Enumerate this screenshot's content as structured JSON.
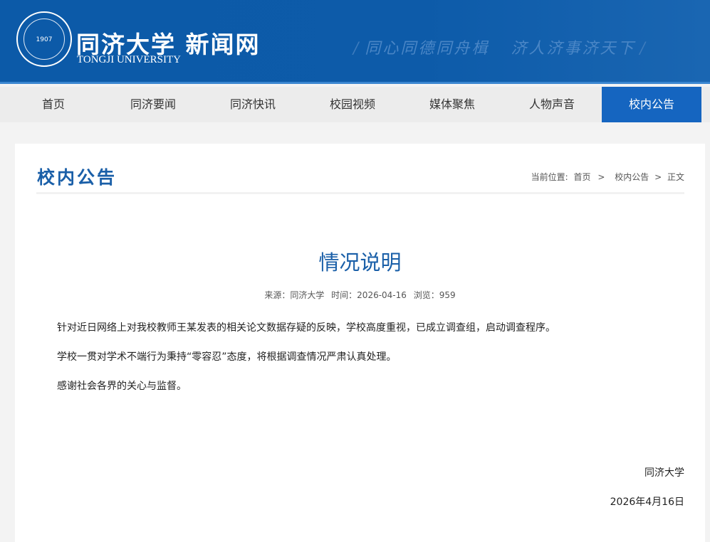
{
  "header": {
    "logo_cn": "同济大学 新闻网",
    "logo_en": "TONGJI UNIVERSITY",
    "seal_text": "1907",
    "motto": [
      "同心同德同舟楫",
      "济人济事济天下"
    ]
  },
  "nav": {
    "items": [
      {
        "label": "首页"
      },
      {
        "label": "同济要闻"
      },
      {
        "label": "同济快讯"
      },
      {
        "label": "校园视频"
      },
      {
        "label": "媒体聚焦"
      },
      {
        "label": "人物声音"
      },
      {
        "label": "校内公告"
      }
    ],
    "active": "校内公告"
  },
  "section": {
    "title": "校内公告"
  },
  "breadcrumb": {
    "prefix": "当前位置:",
    "items": [
      "首页",
      "校内公告",
      "正文"
    ],
    "sep": ">"
  },
  "article": {
    "title": "情况说明",
    "source": "来源：同济大学",
    "time": "时间：2026-04-16",
    "views": "浏览：959",
    "paragraphs": [
      "针对近日网络上对我校教师王某发表的相关论文数据存疑的反映，学校高度重视，已成立调查组，启动调查程序。",
      "学校一贯对学术不端行为秉持“零容忍”态度，将根据调查情况严肃认真处理。",
      "感谢社会各界的关心与监督。"
    ],
    "signature": "同济大学",
    "date": "2026年4月16日"
  }
}
